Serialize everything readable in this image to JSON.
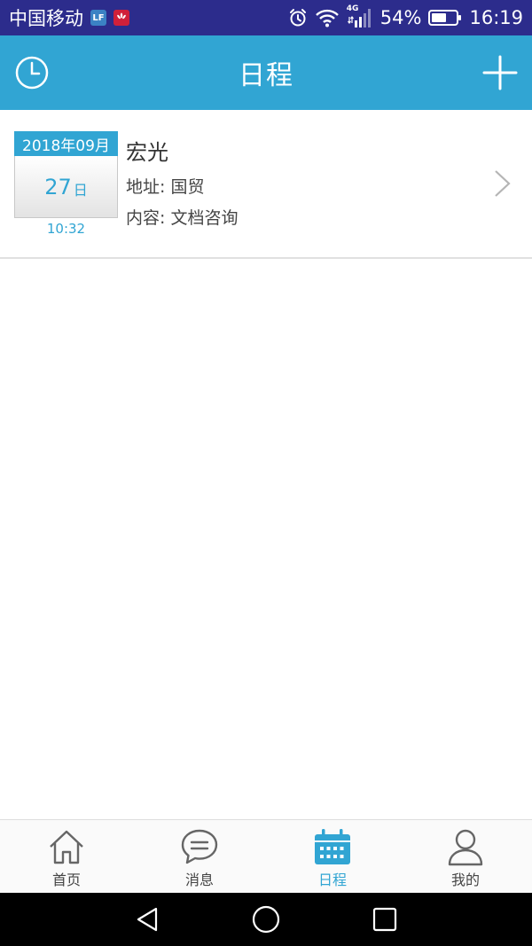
{
  "status_bar": {
    "carrier": "中国移动",
    "badge_lf": "LF",
    "network": "4G",
    "battery": "54%",
    "time": "16:19"
  },
  "header": {
    "title": "日程",
    "left_icon": "clock-icon",
    "right_icon": "plus-icon"
  },
  "schedule": [
    {
      "month": "2018年09月",
      "day": "27",
      "day_unit": "日",
      "time": "10:32",
      "title": "宏光",
      "address": "地址: 国贸",
      "content": "内容: 文档咨询"
    }
  ],
  "tabs": [
    {
      "label": "首页",
      "icon": "home-icon",
      "active": false
    },
    {
      "label": "消息",
      "icon": "message-icon",
      "active": false
    },
    {
      "label": "日程",
      "icon": "calendar-icon",
      "active": true
    },
    {
      "label": "我的",
      "icon": "user-icon",
      "active": false
    }
  ],
  "colors": {
    "accent": "#31a5d3",
    "status_bar": "#2c2c8c"
  }
}
